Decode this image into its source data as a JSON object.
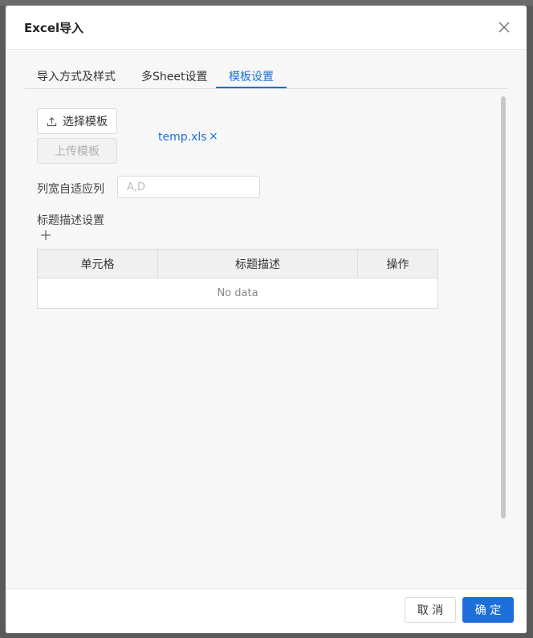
{
  "modal": {
    "title": "Excel导入"
  },
  "tabs": [
    {
      "label": "导入方式及样式",
      "active": false
    },
    {
      "label": "多Sheet设置",
      "active": false
    },
    {
      "label": "模板设置",
      "active": true
    }
  ],
  "template": {
    "choose_button": "选择模板",
    "upload_button": "上传模板",
    "file_name": "temp.xls",
    "remove_symbol": "×"
  },
  "auto_width": {
    "label": "列宽自适应列",
    "placeholder": "A,D",
    "value": ""
  },
  "title_desc": {
    "label": "标题描述设置",
    "columns": [
      "单元格",
      "标题描述",
      "操作"
    ],
    "rows": [],
    "empty_text": "No data"
  },
  "footer": {
    "cancel": "取 消",
    "confirm": "确 定"
  },
  "colors": {
    "accent": "#1e6fd9",
    "overlay": "#5a5a5a"
  }
}
